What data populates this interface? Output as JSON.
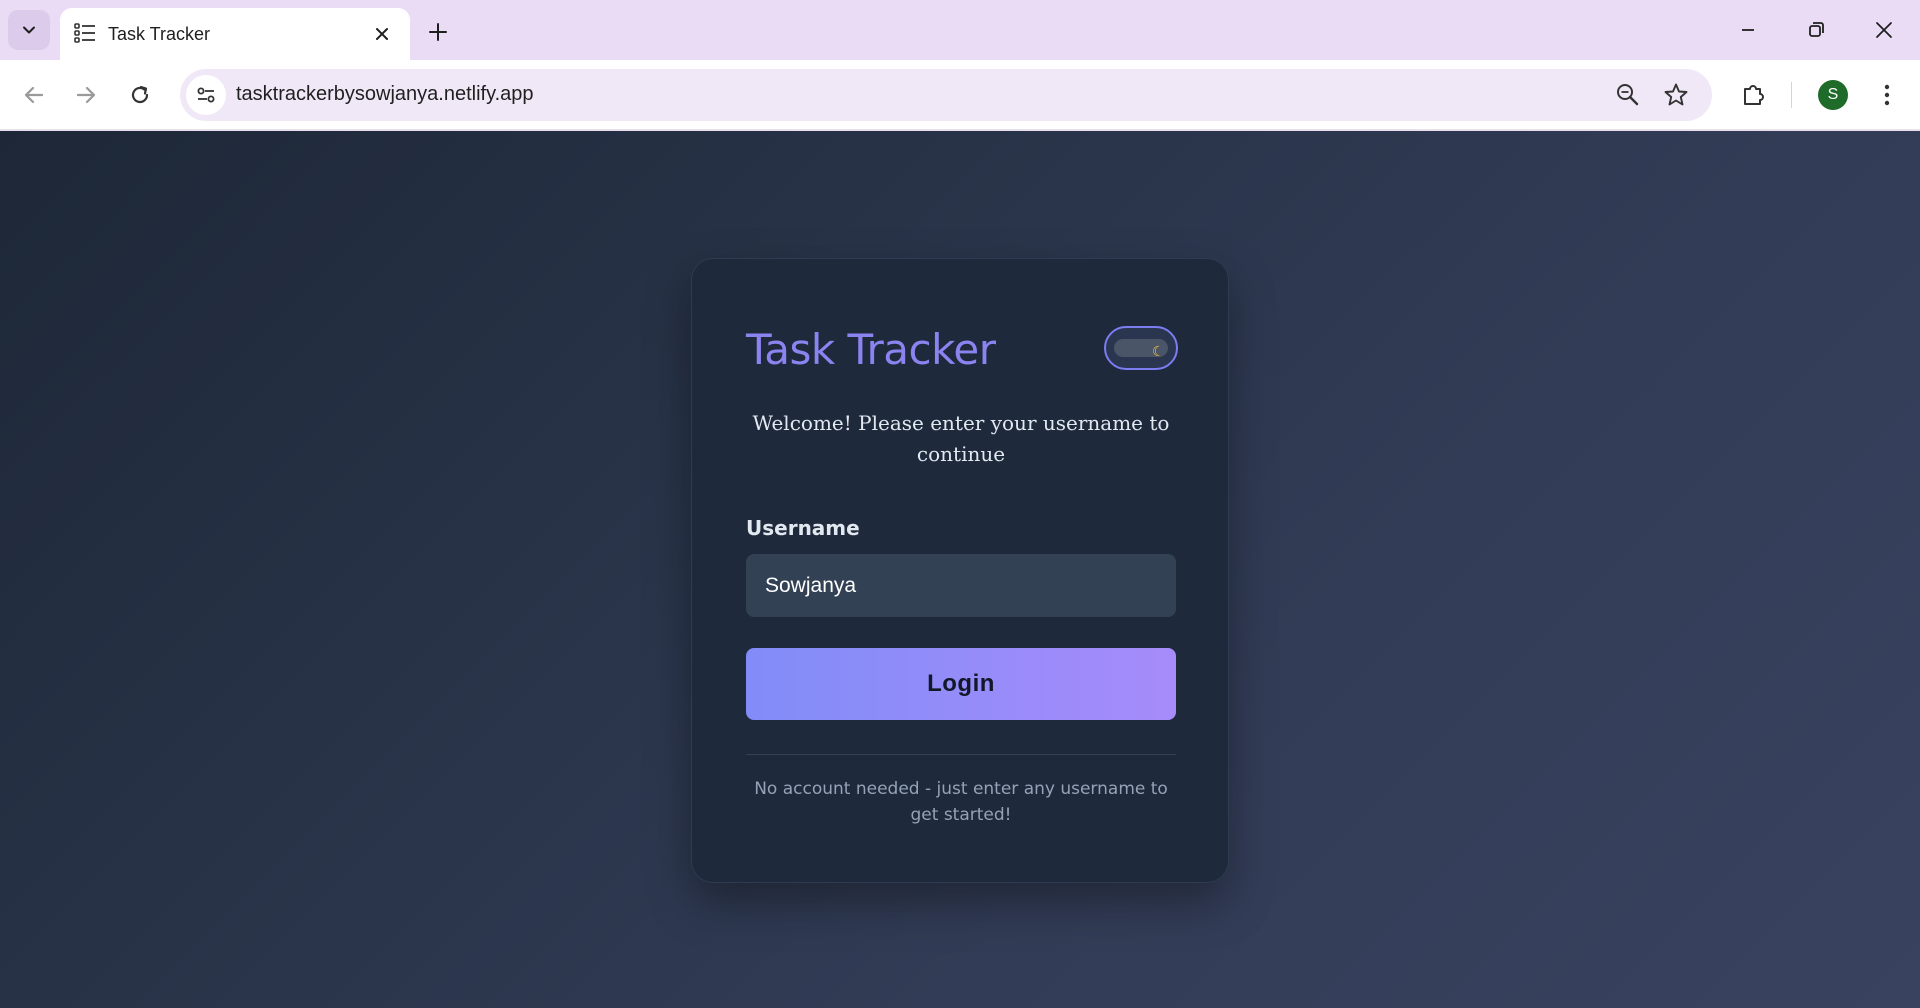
{
  "browser": {
    "tab": {
      "title": "Task Tracker"
    },
    "address_bar": {
      "url": "tasktrackerbysowjanya.netlify.app"
    },
    "profile_initial": "S"
  },
  "login_card": {
    "title": "Task Tracker",
    "welcome_text": "Welcome! Please enter your username to continue",
    "username_label": "Username",
    "username_value": "Sowjanya",
    "login_button": "Login",
    "footer_note": "No account needed - just enter any username to get started!",
    "theme_toggle": {
      "mode": "dark",
      "icon": "moon-icon"
    }
  },
  "colors": {
    "title_accent": "#8b84f0",
    "button_gradient_start": "#818cf8",
    "button_gradient_end": "#a78bfa",
    "card_bg": "#1e293b",
    "avatar_bg": "#1e6b2a"
  }
}
